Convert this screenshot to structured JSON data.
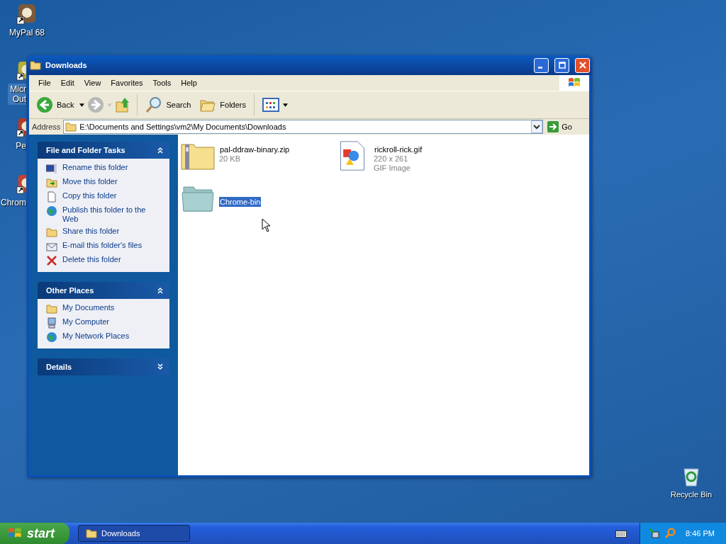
{
  "desktop_icons": [
    {
      "lines": [
        "MyPal 68"
      ],
      "selected": false
    },
    {
      "lines": [
        "Micr",
        "Out"
      ],
      "selected": true
    },
    {
      "lines": [
        "Pe"
      ],
      "selected": false
    },
    {
      "lines": [
        "Chrom"
      ],
      "selected": false
    }
  ],
  "recycle_bin": {
    "label": "Recycle Bin"
  },
  "window": {
    "title": "Downloads",
    "menu": [
      "File",
      "Edit",
      "View",
      "Favorites",
      "Tools",
      "Help"
    ],
    "toolbar": {
      "back": "Back",
      "forward_disabled": true,
      "search": "Search",
      "folders": "Folders"
    },
    "address": {
      "label": "Address",
      "value": "E:\\Documents and Settings\\vm2\\My Documents\\Downloads",
      "go": "Go"
    },
    "panels": [
      {
        "title": "File and Folder Tasks",
        "expanded": true,
        "items": [
          "Rename this folder",
          "Move this folder",
          "Copy this folder",
          "Publish this folder to the Web",
          "Share this folder",
          "E-mail this folder's files",
          "Delete this folder"
        ]
      },
      {
        "title": "Other Places",
        "expanded": true,
        "items": [
          "My Documents",
          "My Computer",
          "My Network Places"
        ]
      },
      {
        "title": "Details",
        "expanded": false
      }
    ],
    "files": [
      {
        "kind": "zip",
        "name": "pal-ddraw-binary.zip",
        "details": [
          "20 KB"
        ],
        "selected": false
      },
      {
        "kind": "image",
        "name": "rickroll-rick.gif",
        "details": [
          "220 x 261",
          "GIF Image"
        ],
        "selected": false
      },
      {
        "kind": "folder",
        "name": "Chrome-bin",
        "selected": true
      }
    ]
  },
  "taskbar": {
    "start": "start",
    "tasks": [
      {
        "label": "Downloads",
        "selected": true
      }
    ],
    "clock": "8:46 PM"
  }
}
